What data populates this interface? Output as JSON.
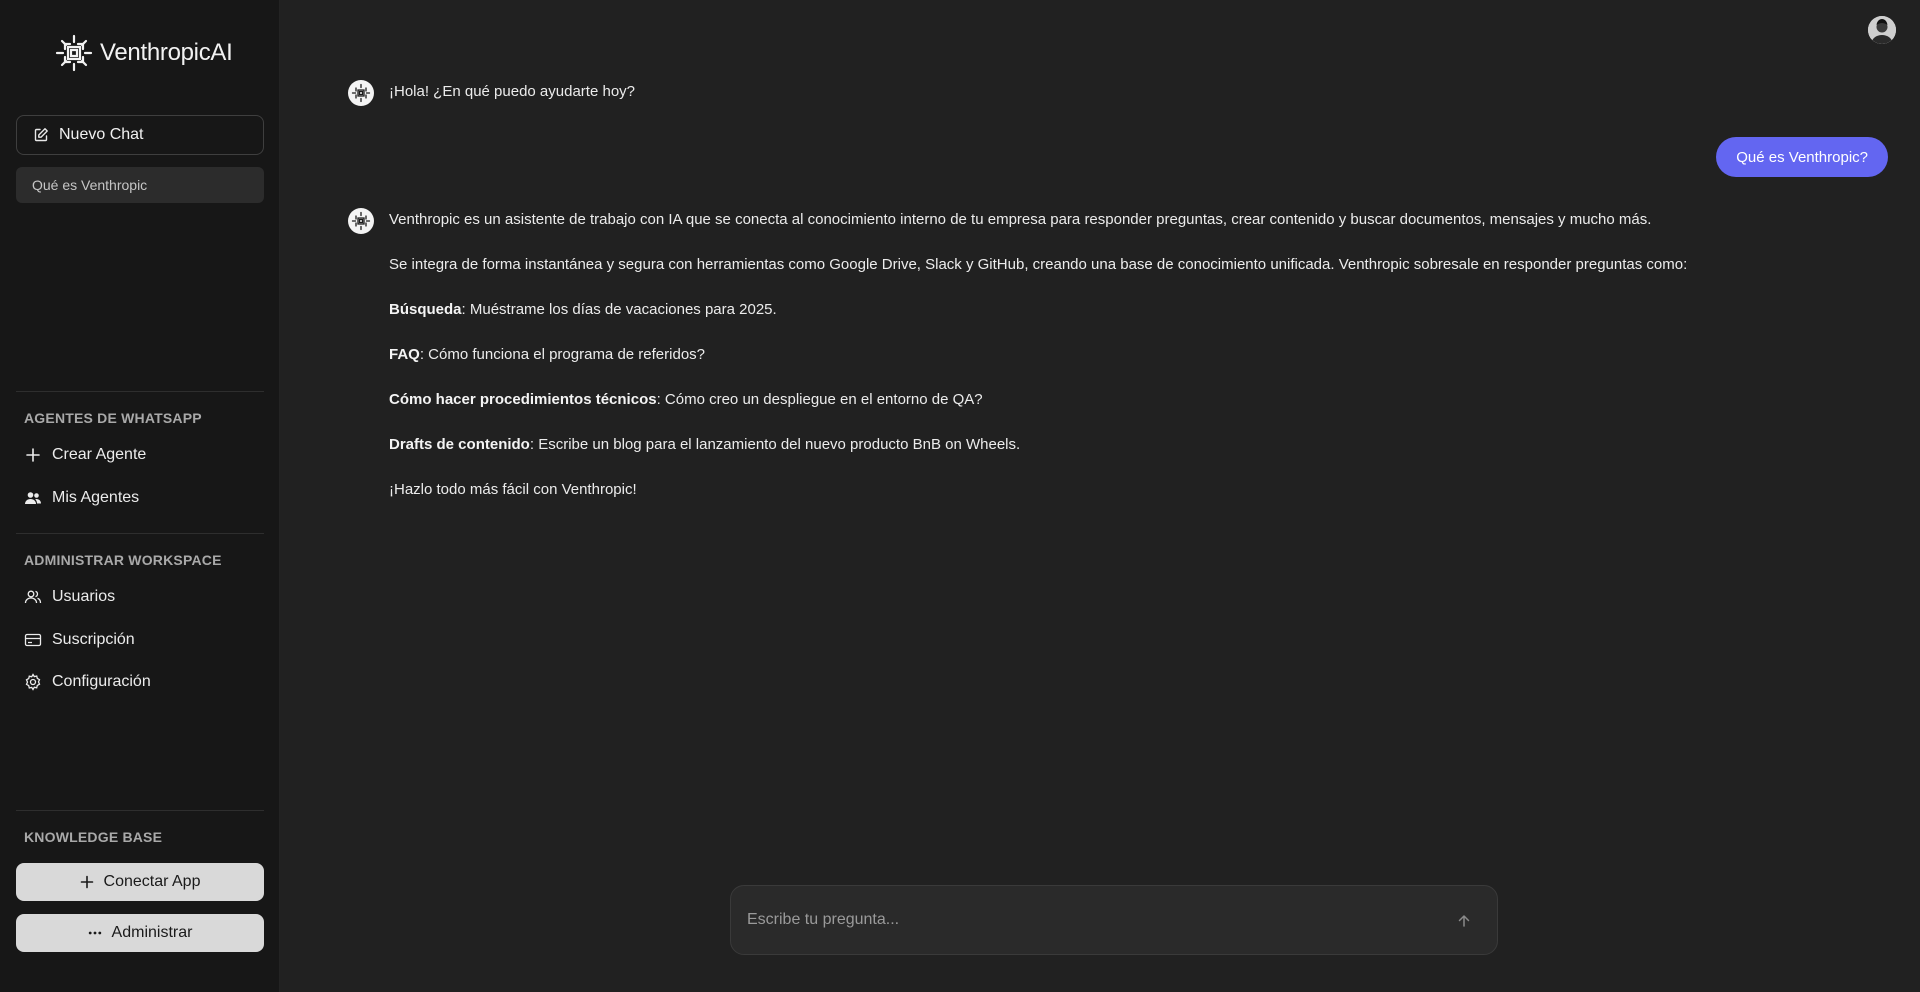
{
  "app": {
    "logo_text": "VenthropicAI"
  },
  "sidebar": {
    "new_chat_label": "Nuevo Chat",
    "history": [
      {
        "label": "Qué es Venthropic"
      }
    ],
    "sections": {
      "whatsapp": {
        "title": "AGENTES DE WHATSAPP",
        "items": [
          {
            "label": "Crear Agente",
            "icon": "plus-icon"
          },
          {
            "label": "Mis Agentes",
            "icon": "users-icon"
          }
        ]
      },
      "workspace": {
        "title": "ADMINISTRAR WORKSPACE",
        "items": [
          {
            "label": "Usuarios",
            "icon": "user-group-icon"
          },
          {
            "label": "Suscripción",
            "icon": "credit-card-icon"
          },
          {
            "label": "Configuración",
            "icon": "gear-icon"
          }
        ]
      },
      "knowledge": {
        "title": "KNOWLEDGE BASE",
        "connect_label": "Conectar App",
        "manage_label": "Administrar"
      }
    }
  },
  "chat": {
    "greeting": "¡Hola! ¿En qué puedo ayudarte hoy?",
    "user_message": "Qué es Venthropic?",
    "answer": {
      "p1": "Venthropic es un asistente de trabajo con IA que se conecta al conocimiento interno de tu empresa para responder preguntas, crear contenido y buscar documentos, mensajes y mucho más.",
      "p2": "Se integra de forma instantánea y segura con herramientas como Google Drive, Slack y GitHub, creando una base de conocimiento unificada. Venthropic sobresale en responder preguntas como:",
      "examples": [
        {
          "bold": "Búsqueda",
          "text": ": Muéstrame los días de vacaciones para 2025."
        },
        {
          "bold": "FAQ",
          "text": ": Cómo funciona el programa de referidos?"
        },
        {
          "bold": "Cómo hacer procedimientos técnicos",
          "text": ": Cómo creo un despliegue en el entorno de QA?"
        },
        {
          "bold": "Drafts de contenido",
          "text": ": Escribe un blog para el lanzamiento del nuevo producto BnB on Wheels."
        }
      ],
      "closing": "¡Hazlo todo más fácil con Venthropic!"
    }
  },
  "composer": {
    "placeholder": "Escribe tu pregunta...",
    "value": ""
  },
  "colors": {
    "accent": "#6366f1",
    "sidebar_bg": "#171717",
    "main_bg": "#212121"
  }
}
